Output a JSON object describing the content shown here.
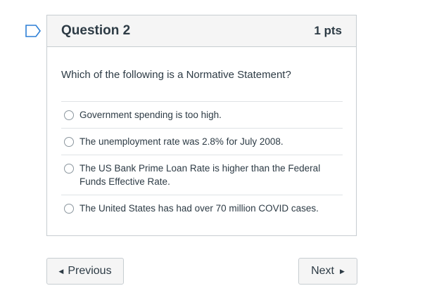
{
  "flag": {
    "icon": "flag-bookmark-icon",
    "color": "#2d7fd5"
  },
  "question": {
    "title": "Question 2",
    "points": "1 pts",
    "text": "Which of the following is a Normative Statement?",
    "answers": [
      {
        "label": "Government spending is too high."
      },
      {
        "label": "The unemployment rate was 2.8% for July 2008."
      },
      {
        "label": "The US Bank Prime Loan Rate is higher than the Federal Funds Effective Rate."
      },
      {
        "label": "The United States has had over 70 million COVID cases."
      }
    ]
  },
  "nav": {
    "previous_label": "Previous",
    "next_label": "Next",
    "previous_icon": "triangle-left-icon",
    "next_icon": "triangle-right-icon"
  }
}
